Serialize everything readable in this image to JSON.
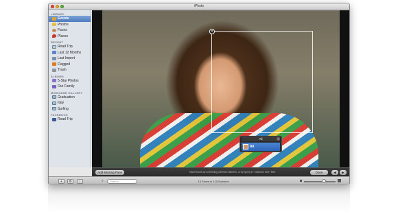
{
  "window": {
    "title": "iPhoto"
  },
  "sidebar": {
    "sections": [
      {
        "header": "LIBRARY",
        "items": [
          {
            "label": "Events",
            "icon": "events-icon",
            "selected": true
          },
          {
            "label": "Photos",
            "icon": "photos-icon"
          },
          {
            "label": "Faces",
            "icon": "faces-icon"
          },
          {
            "label": "Places",
            "icon": "places-icon"
          }
        ]
      },
      {
        "header": "RECENT",
        "items": [
          {
            "label": "Road Trip",
            "icon": "event-thumbnail-icon"
          },
          {
            "label": "Last 12 Months",
            "icon": "calendar-icon"
          },
          {
            "label": "Last Import",
            "icon": "import-icon"
          },
          {
            "label": "Flagged",
            "icon": "flag-icon"
          },
          {
            "label": "Trash",
            "icon": "trash-icon"
          }
        ]
      },
      {
        "header": "ALBUMS",
        "items": [
          {
            "label": "5-Star Photos",
            "icon": "smart-album-icon"
          },
          {
            "label": "Our Family",
            "icon": "album-icon"
          }
        ]
      },
      {
        "header": "MOBILEME GALLERY",
        "items": [
          {
            "label": "Graduation",
            "icon": "gallery-icon"
          },
          {
            "label": "Italy",
            "icon": "gallery-icon"
          },
          {
            "label": "Surfing",
            "icon": "gallery-icon"
          }
        ]
      },
      {
        "header": "FACEBOOK",
        "items": [
          {
            "label": "Road Trip",
            "icon": "facebook-icon"
          }
        ]
      }
    ]
  },
  "face_tag": {
    "name_field_value": "Ali",
    "suggestion": "Ali"
  },
  "infobar": {
    "add_missing_label": "Add Missing Face",
    "hint_text": "Name faces by confirming potential matches, or by typing in \"unknown face\" field.",
    "done_label": "Done"
  },
  "bottombar": {
    "search_placeholder": "Search",
    "status_text": "14 Faces in 1,015 photos"
  },
  "colors": {
    "selection_blue": "#4e7cbe",
    "suggestion_blue": "#2e65b8"
  }
}
